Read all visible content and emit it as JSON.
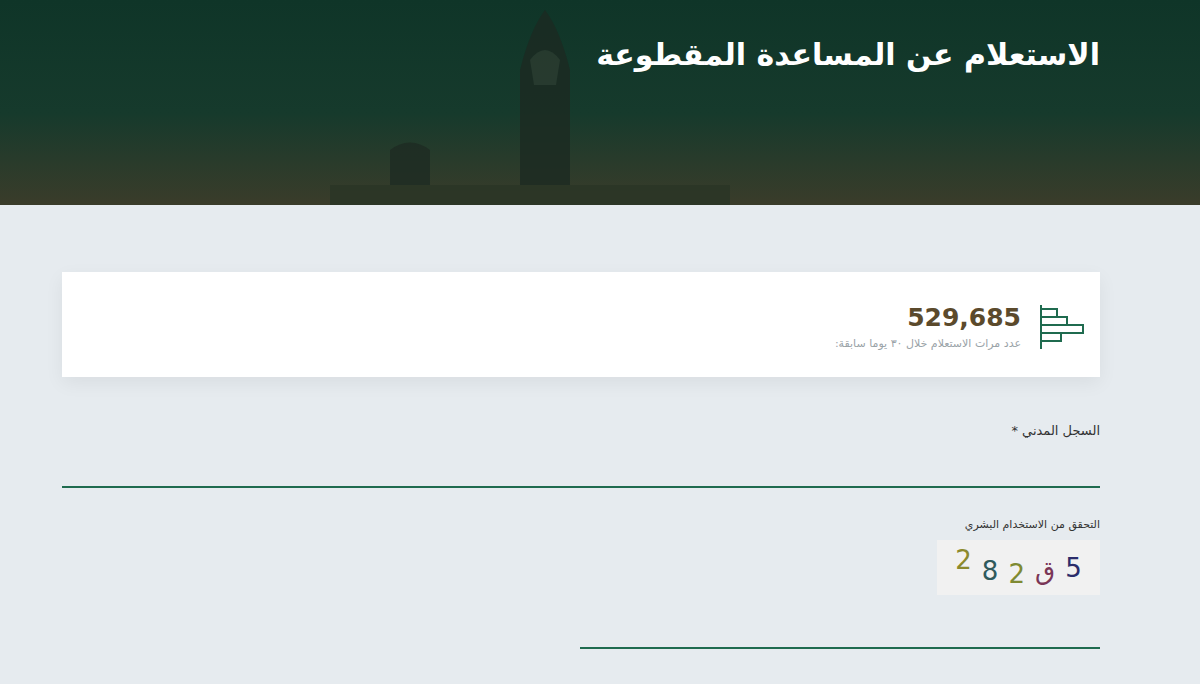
{
  "header": {
    "title": "الاستعلام عن المساعدة المقطوعة"
  },
  "stats": {
    "count": "529,685",
    "caption": "عدد مرات الاستعلام خلال ٣٠ يوما سابقة:"
  },
  "national_id": {
    "label": "السجل المدني *"
  },
  "captcha": {
    "label": "التحقق من الاستخدام البشري",
    "characters": [
      {
        "char": "2",
        "color": "#8c8a2e"
      },
      {
        "char": "8",
        "color": "#2f5a5c"
      },
      {
        "char": "2",
        "color": "#7f8a32"
      },
      {
        "char": "ق",
        "color": "#7a3656"
      },
      {
        "char": "5",
        "color": "#2b2d6b"
      }
    ]
  }
}
